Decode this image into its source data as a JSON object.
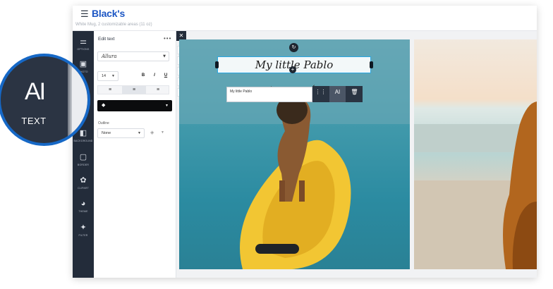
{
  "header": {
    "logo": "Black's",
    "subtitle": "White Mug, 2 customizable areas (11 oz)",
    "menu_icon": "hamburger-menu-icon"
  },
  "sidebar": {
    "items": [
      {
        "label": "OPTIONS",
        "icon": "sliders-icon"
      },
      {
        "label": "PHOTO",
        "icon": "image-icon"
      },
      {
        "label": "BACKGROUND",
        "icon": "background-icon"
      },
      {
        "label": "BORDER",
        "icon": "border-icon"
      },
      {
        "label": "CLIPART",
        "icon": "clipart-icon"
      },
      {
        "label": "THEME",
        "icon": "palette-icon"
      },
      {
        "label": "FILTER",
        "icon": "sparkle-icon"
      }
    ]
  },
  "panel": {
    "title": "Edit text",
    "more_label": "•••",
    "font": "Allura",
    "size": "14",
    "bold": "B",
    "italic": "I",
    "underline": "U",
    "align_left": "≡",
    "align_center": "≡",
    "align_right": "≡",
    "color_icon": "fill-bucket-icon",
    "outline_label": "Outline",
    "outline_value": "None"
  },
  "canvas": {
    "text_value": "My little Pablo",
    "input_value": "My little Pablo"
  },
  "callout": {
    "icon_text": "AI",
    "label": "TEXT"
  },
  "colors": {
    "accent": "#1c56c4",
    "rail_bg": "#232c3a",
    "selection": "#2aa7e3"
  }
}
